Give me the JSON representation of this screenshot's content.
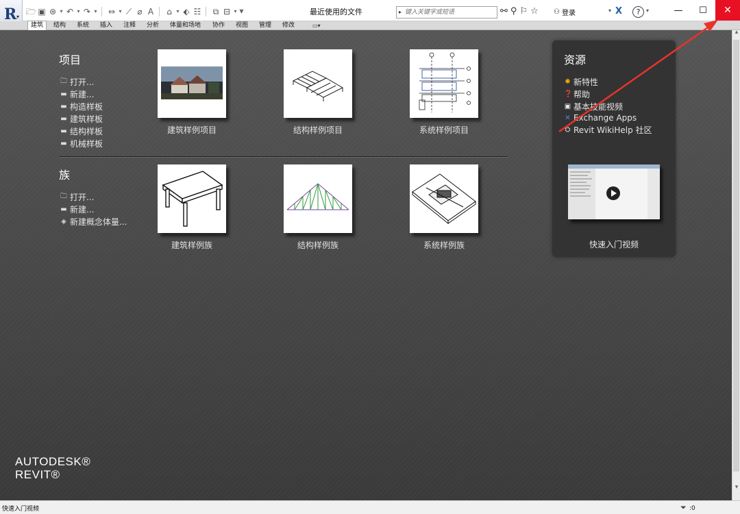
{
  "titlebar": {
    "app_logo": "R",
    "window_title": "最近使用的文件",
    "search_placeholder": "键入关键字或短语",
    "login_label": "登录",
    "help_label": "?",
    "exchange_icon": "X",
    "minimize": "—",
    "maximize": "☐",
    "close": "✕"
  },
  "ribbon_tabs": [
    "建筑",
    "结构",
    "系统",
    "插入",
    "注释",
    "分析",
    "体量和场地",
    "协作",
    "视图",
    "管理",
    "修改"
  ],
  "projects": {
    "title": "项目",
    "links": [
      {
        "icon": "folder-open-icon",
        "label": "打开..."
      },
      {
        "icon": "new-file-icon",
        "label": "新建..."
      },
      {
        "icon": "template-icon",
        "label": "构造样板"
      },
      {
        "icon": "template-icon",
        "label": "建筑样板"
      },
      {
        "icon": "template-icon",
        "label": "结构样板"
      },
      {
        "icon": "template-icon",
        "label": "机械样板"
      }
    ],
    "thumbnails": [
      {
        "label": "建筑样例项目"
      },
      {
        "label": "结构样例项目"
      },
      {
        "label": "系统样例项目"
      }
    ]
  },
  "families": {
    "title": "族",
    "links": [
      {
        "icon": "folder-open-icon",
        "label": "打开..."
      },
      {
        "icon": "new-file-icon",
        "label": "新建..."
      },
      {
        "icon": "conceptual-mass-icon",
        "label": "新建概念体量..."
      }
    ],
    "thumbnails": [
      {
        "label": "建筑样例族"
      },
      {
        "label": "结构样例族"
      },
      {
        "label": "系统样例族"
      }
    ]
  },
  "resources": {
    "title": "资源",
    "links": [
      {
        "icon": "sun-icon",
        "label": "新特性"
      },
      {
        "icon": "help-icon",
        "label": "帮助"
      },
      {
        "icon": "video-icon",
        "label": "基本技能视频"
      },
      {
        "icon": "exchange-icon",
        "label": "Exchange Apps"
      },
      {
        "icon": "wikihelp-icon",
        "label": "Revit WikiHelp 社区"
      }
    ],
    "video_label": "快速入门视频"
  },
  "branding": {
    "line1": "AUTODESK®",
    "line2": "REVIT®"
  },
  "statusbar": {
    "text": "快速入门视频",
    "filter_count": ":0"
  },
  "colors": {
    "close_button": "#e81123",
    "annotation_arrow": "#e8332a",
    "panel_bg": "#333333"
  }
}
